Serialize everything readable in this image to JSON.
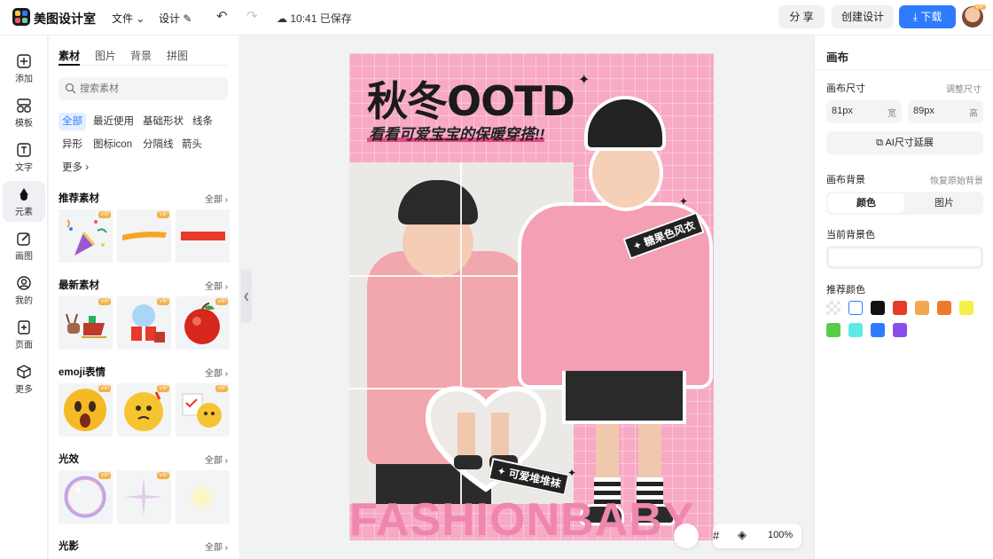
{
  "header": {
    "app_name": "美图设计室",
    "menu_file": "文件",
    "menu_design": "设计",
    "save_status": "10:41 已保存",
    "share_label": "分 享",
    "create_label": "创建设计",
    "download_label": "下载",
    "avatar_badge": "VIP"
  },
  "rail": {
    "items": [
      {
        "label": "添加",
        "icon": "plus-box-icon"
      },
      {
        "label": "模板",
        "icon": "template-icon"
      },
      {
        "label": "文字",
        "icon": "text-icon"
      },
      {
        "label": "元素",
        "icon": "shapes-icon"
      },
      {
        "label": "画图",
        "icon": "draw-icon"
      },
      {
        "label": "我的",
        "icon": "user-icon"
      },
      {
        "label": "页面",
        "icon": "page-add-icon"
      },
      {
        "label": "更多",
        "icon": "cube-icon"
      }
    ],
    "active": "元素"
  },
  "panel": {
    "tabs": [
      "素材",
      "图片",
      "背景",
      "拼图"
    ],
    "search_placeholder": "搜索素材",
    "chips_row1": [
      "全部",
      "最近使用",
      "基础形状",
      "线条"
    ],
    "chips_row2": [
      "异形",
      "图标icon",
      "分隔线",
      "箭头"
    ],
    "more": "更多",
    "all_label": "全部",
    "vip": "VIP",
    "sections": [
      {
        "title": "推荐素材"
      },
      {
        "title": "最新素材"
      },
      {
        "title": "emoji表情"
      },
      {
        "title": "光效"
      },
      {
        "title": "光影"
      }
    ]
  },
  "poster": {
    "title": "秋冬OOTD",
    "subtitle": "看看可爱宝宝的保暖穿搭!!",
    "tag1": "糖果色风衣",
    "tag2": "可爱堆堆袜",
    "watermark": "FASHIONBABY",
    "bg_color": "#f7a9c5"
  },
  "canvas_tools": {
    "zoom": "100%"
  },
  "props": {
    "title": "画布",
    "size_label": "画布尺寸",
    "adjust_size": "调整尺寸",
    "width_value": "81px",
    "width_unit": "宽",
    "height_value": "89px",
    "height_unit": "高",
    "ai_expand": "AI尺寸延展",
    "bg_label": "画布背景",
    "restore_bg": "恢复原始背景",
    "seg_color": "颜色",
    "seg_image": "图片",
    "current_bg_label": "当前背景色",
    "recommend_label": "推荐颜色",
    "swatches": [
      "transparent",
      "#ffffff",
      "#111111",
      "#e8392a",
      "#f2a84e",
      "#ef7a2f",
      "#f5ef47",
      "#56cc48",
      "#60e8e6",
      "#2f7bff",
      "#8b4cf0"
    ]
  }
}
